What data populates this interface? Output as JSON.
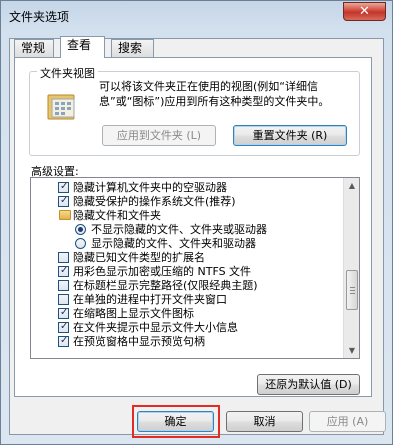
{
  "window": {
    "title": "文件夹选项",
    "close_glyph": "✕"
  },
  "tabs": [
    {
      "label": "常规",
      "active": false
    },
    {
      "label": "查看",
      "active": true
    },
    {
      "label": "搜索",
      "active": false
    }
  ],
  "folder_views": {
    "group_label": "文件夹视图",
    "description": "可以将该文件夹正在使用的视图(例如“详细信息”或“图标”)应用到所有这种类型的文件夹中。",
    "apply_button": "应用到文件夹 (L)",
    "reset_button": "重置文件夹 (R)"
  },
  "advanced": {
    "label": "高级设置:",
    "items": [
      {
        "type": "checkbox",
        "checked": true,
        "label": "隐藏计算机文件夹中的空驱动器"
      },
      {
        "type": "checkbox",
        "checked": true,
        "label": "隐藏受保护的操作系统文件(推荐)"
      },
      {
        "type": "folder",
        "label": "隐藏文件和文件夹"
      },
      {
        "type": "radio",
        "checked": true,
        "label": "不显示隐藏的文件、文件夹或驱动器"
      },
      {
        "type": "radio",
        "checked": false,
        "label": "显示隐藏的文件、文件夹和驱动器"
      },
      {
        "type": "checkbox",
        "checked": false,
        "label": "隐藏已知文件类型的扩展名"
      },
      {
        "type": "checkbox",
        "checked": true,
        "label": "用彩色显示加密或压缩的 NTFS 文件"
      },
      {
        "type": "checkbox",
        "checked": false,
        "label": "在标题栏显示完整路径(仅限经典主题)"
      },
      {
        "type": "checkbox",
        "checked": false,
        "label": "在单独的进程中打开文件夹窗口"
      },
      {
        "type": "checkbox",
        "checked": true,
        "label": "在缩略图上显示文件图标"
      },
      {
        "type": "checkbox",
        "checked": true,
        "label": "在文件夹提示中显示文件大小信息"
      },
      {
        "type": "checkbox",
        "checked": true,
        "label": "在预览窗格中显示预览句柄"
      }
    ],
    "restore_button": "还原为默认值 (D)"
  },
  "footer": {
    "ok": "确定",
    "cancel": "取消",
    "apply": "应用 (A)"
  },
  "colors": {
    "highlight": "#e22b22",
    "close": "#c0362a"
  }
}
